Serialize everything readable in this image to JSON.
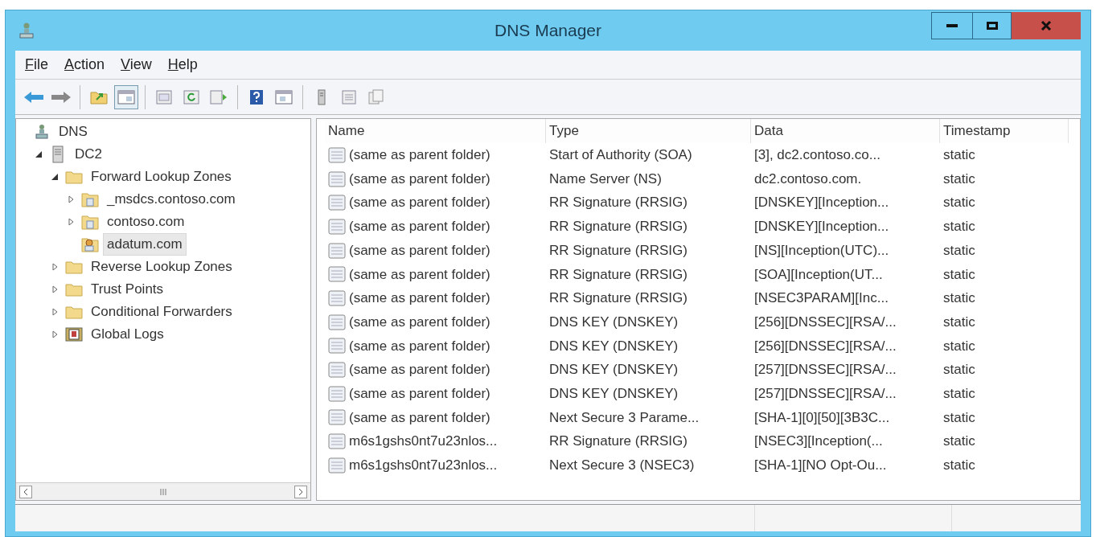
{
  "window": {
    "title": "DNS Manager"
  },
  "menu": [
    "File",
    "Action",
    "View",
    "Help"
  ],
  "tree": [
    {
      "label": "DNS",
      "kind": "root",
      "selected": false,
      "children": [
        {
          "label": "DC2",
          "kind": "server",
          "expanded": true,
          "selected": false,
          "children": [
            {
              "label": "Forward Lookup Zones",
              "kind": "folder",
              "expanded": true,
              "selected": false,
              "children": [
                {
                  "label": "_msdcs.contoso.com",
                  "kind": "zone",
                  "expanded": false,
                  "selected": false
                },
                {
                  "label": "contoso.com",
                  "kind": "zone",
                  "expanded": false,
                  "selected": false
                },
                {
                  "label": "adatum.com",
                  "kind": "signed-zone",
                  "selected": true
                }
              ]
            },
            {
              "label": "Reverse Lookup Zones",
              "kind": "folder",
              "expanded": false,
              "selected": false
            },
            {
              "label": "Trust Points",
              "kind": "folder",
              "expanded": false,
              "selected": false
            },
            {
              "label": "Conditional Forwarders",
              "kind": "folder",
              "expanded": false,
              "selected": false
            },
            {
              "label": "Global Logs",
              "kind": "logs",
              "expanded": false,
              "selected": false
            }
          ]
        }
      ]
    }
  ],
  "table": {
    "columns": [
      "Name",
      "Type",
      "Data",
      "Timestamp"
    ],
    "rows": [
      [
        "(same as parent folder)",
        "Start of Authority (SOA)",
        "[3], dc2.contoso.co...",
        "static"
      ],
      [
        "(same as parent folder)",
        "Name Server (NS)",
        "dc2.contoso.com.",
        "static"
      ],
      [
        "(same as parent folder)",
        "RR Signature (RRSIG)",
        "[DNSKEY][Inception...",
        "static"
      ],
      [
        "(same as parent folder)",
        "RR Signature (RRSIG)",
        "[DNSKEY][Inception...",
        "static"
      ],
      [
        "(same as parent folder)",
        "RR Signature (RRSIG)",
        "[NS][Inception(UTC)...",
        "static"
      ],
      [
        "(same as parent folder)",
        "RR Signature (RRSIG)",
        "[SOA][Inception(UT...",
        "static"
      ],
      [
        "(same as parent folder)",
        "RR Signature (RRSIG)",
        "[NSEC3PARAM][Inc...",
        "static"
      ],
      [
        "(same as parent folder)",
        "DNS KEY (DNSKEY)",
        "[256][DNSSEC][RSA/...",
        "static"
      ],
      [
        "(same as parent folder)",
        "DNS KEY (DNSKEY)",
        "[256][DNSSEC][RSA/...",
        "static"
      ],
      [
        "(same as parent folder)",
        "DNS KEY (DNSKEY)",
        "[257][DNSSEC][RSA/...",
        "static"
      ],
      [
        "(same as parent folder)",
        "DNS KEY (DNSKEY)",
        "[257][DNSSEC][RSA/...",
        "static"
      ],
      [
        "(same as parent folder)",
        "Next Secure 3 Parame...",
        "[SHA-1][0][50][3B3C...",
        "static"
      ],
      [
        "m6s1gshs0nt7u23nlos...",
        "RR Signature (RRSIG)",
        "[NSEC3][Inception(...",
        "static"
      ],
      [
        "m6s1gshs0nt7u23nlos...",
        "Next Secure 3 (NSEC3)",
        "[SHA-1][NO Opt-Ou...",
        "static"
      ]
    ]
  }
}
